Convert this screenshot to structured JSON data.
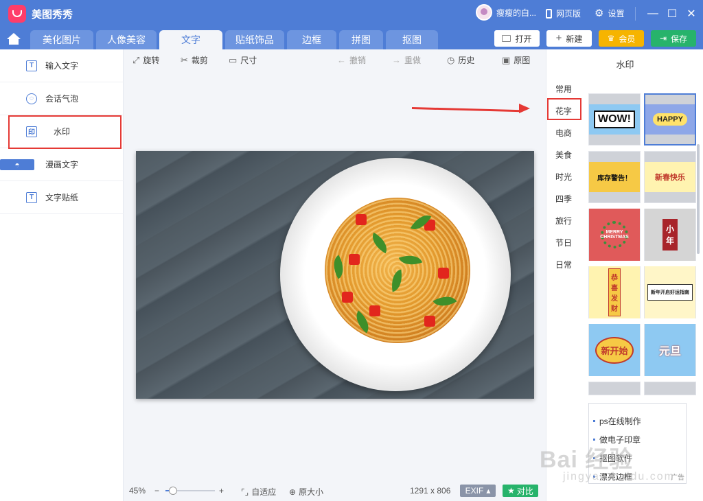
{
  "app": {
    "title": "美图秀秀"
  },
  "titlebar": {
    "username": "瘦瘦的白...",
    "web_version": "网页版",
    "settings": "设置"
  },
  "tabs": [
    {
      "label": "美化图片",
      "active": false
    },
    {
      "label": "人像美容",
      "active": false
    },
    {
      "label": "文字",
      "active": true
    },
    {
      "label": "贴纸饰品",
      "active": false
    },
    {
      "label": "边框",
      "active": false
    },
    {
      "label": "拼图",
      "active": false
    },
    {
      "label": "抠图",
      "active": false
    }
  ],
  "top_buttons": {
    "open": "打开",
    "new": "新建",
    "vip": "会员",
    "save": "保存"
  },
  "left_panel": {
    "items": [
      {
        "label": "输入文字",
        "icon": "T"
      },
      {
        "label": "会话气泡",
        "icon": "◌"
      },
      {
        "label": "水印",
        "icon": "印"
      },
      {
        "label": "漫画文字",
        "icon": "◓"
      },
      {
        "label": "文字贴纸",
        "icon": "T"
      }
    ],
    "highlighted": "水印"
  },
  "toolbar": {
    "rotate": "旋转",
    "crop": "裁剪",
    "size": "尺寸",
    "undo": "撤销",
    "redo": "重做",
    "history": "历史",
    "original": "原图"
  },
  "status": {
    "zoom": "45%",
    "zoom_fraction": 0.15,
    "fit": "自适应",
    "actual_size": "原大小",
    "dimensions": "1291 x 806",
    "exif": "EXIF",
    "compare": "对比"
  },
  "right_panel": {
    "title": "水印",
    "categories": [
      "常用",
      "花字",
      "电商",
      "美食",
      "时光",
      "四季",
      "旅行",
      "节日",
      "日常"
    ],
    "selected_category": "花字",
    "thumbnails": [
      {
        "text": "WOW!",
        "bg": "#8ec9f2"
      },
      {
        "text": "HAPPY",
        "bg": "#8ea7e8"
      },
      {
        "text": "库存警告！",
        "bg": "#f6c945"
      },
      {
        "text": "新春快乐",
        "bg": "#fff3b0"
      },
      {
        "text": "MERRY CHRISTMAS",
        "bg": "#e05a5a"
      },
      {
        "text": "小年",
        "bg": "#d5d5d5"
      },
      {
        "text": "恭喜发财",
        "bg": "#fff3b0"
      },
      {
        "text": "新年开启好运指南",
        "bg": "#fff6c8"
      },
      {
        "text": "新开始",
        "bg": "#8ec9f2"
      },
      {
        "text": "元旦",
        "bg": "#8ec9f2"
      }
    ]
  },
  "ads": {
    "items": [
      "ps在线制作",
      "做电子印章",
      "抠图软件",
      "漂亮边框"
    ],
    "tag": "广告"
  },
  "watermark": {
    "brand": "Bai 经验",
    "url": "jingyan.baidu.com"
  }
}
